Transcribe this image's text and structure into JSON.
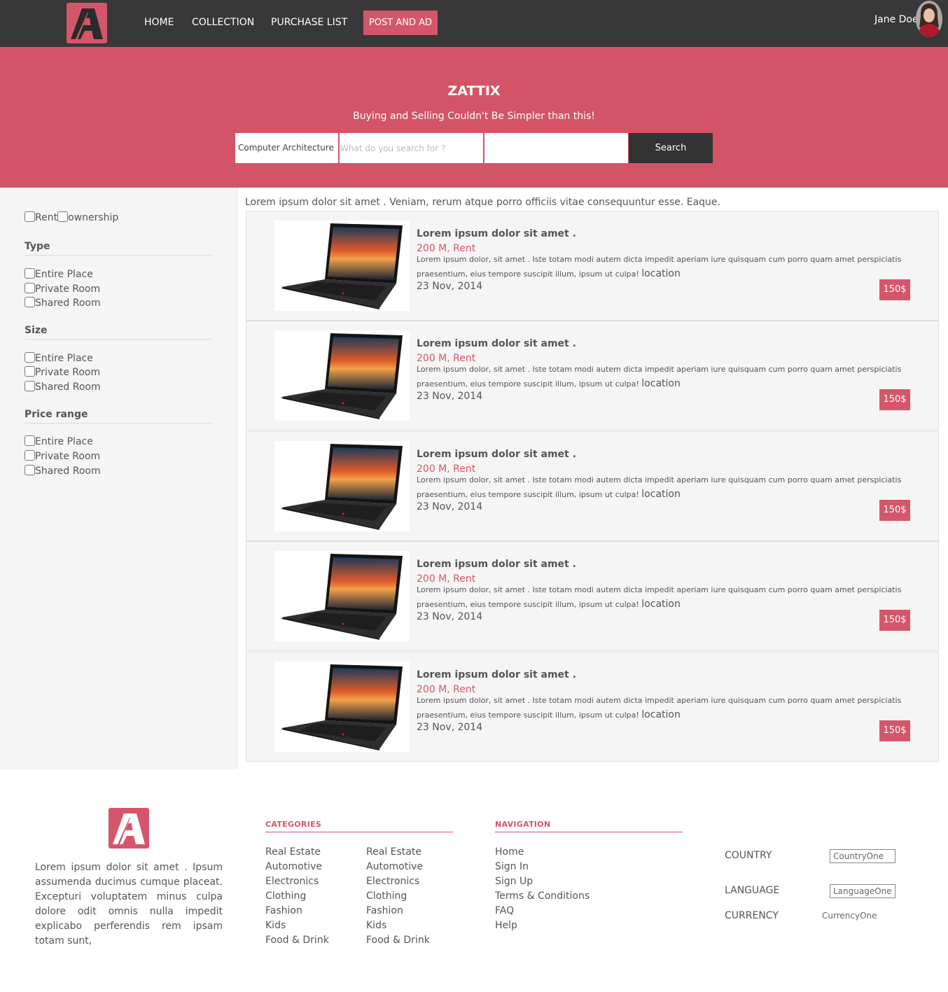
{
  "navbar": {
    "links": [
      "HOME",
      "COLLECTION",
      "PURCHASE LIST"
    ],
    "post_ad": "POST AND AD",
    "user_name": "Jane Doe"
  },
  "hero": {
    "title": "ZATTIX",
    "subtitle": "Buying and Selling Couldn't Be Simpler than this!",
    "category": "Computer Architecture",
    "search_placeholder": "What do you search for ?",
    "search_button": "Search"
  },
  "filters": {
    "deal_options": [
      "Rent",
      "ownership"
    ],
    "groups": [
      {
        "title": "Type",
        "options": [
          "Entire Place",
          "Private Room",
          "Shared Room"
        ]
      },
      {
        "title": "Size",
        "options": [
          "Entire Place",
          "Private Room",
          "Shared Room"
        ]
      },
      {
        "title": "Price range",
        "options": [
          "Entire Place",
          "Private Room",
          "Shared Room"
        ]
      }
    ]
  },
  "listings_intro": "Lorem ipsum dolor sit amet . Veniam, rerum atque porro officiis vitae consequuntur esse. Eaque.",
  "listings": [
    {
      "title": "Lorem ipsum dolor sit amet .",
      "price": "200 M, Rent",
      "description": "Lorem ipsum dolor, sit amet . Iste totam modi autem dicta impedit aperiam iure quisquam cum porro quam amet perspiciatis praesentium, eius tempore suscipit illum, ipsum ut culpa!",
      "location": "location",
      "date": "23 Nov, 2014",
      "badge": "150$"
    },
    {
      "title": "Lorem ipsum dolor sit amet .",
      "price": "200 M, Rent",
      "description": "Lorem ipsum dolor, sit amet . Iste totam modi autem dicta impedit aperiam iure quisquam cum porro quam amet perspiciatis praesentium, eius tempore suscipit illum, ipsum ut culpa!",
      "location": "location",
      "date": "23 Nov, 2014",
      "badge": "150$"
    },
    {
      "title": "Lorem ipsum dolor sit amet .",
      "price": "200 M, Rent",
      "description": "Lorem ipsum dolor, sit amet . Iste totam modi autem dicta impedit aperiam iure quisquam cum porro quam amet perspiciatis praesentium, eius tempore suscipit illum, ipsum ut culpa!",
      "location": "location",
      "date": "23 Nov, 2014",
      "badge": "150$"
    },
    {
      "title": "Lorem ipsum dolor sit amet .",
      "price": "200 M, Rent",
      "description": "Lorem ipsum dolor, sit amet . Iste totam modi autem dicta impedit aperiam iure quisquam cum porro quam amet perspiciatis praesentium, eius tempore suscipit illum, ipsum ut culpa!",
      "location": "location",
      "date": "23 Nov, 2014",
      "badge": "150$"
    },
    {
      "title": "Lorem ipsum dolor sit amet .",
      "price": "200 M, Rent",
      "description": "Lorem ipsum dolor, sit amet . Iste totam modi autem dicta impedit aperiam iure quisquam cum porro quam amet perspiciatis praesentium, eius tempore suscipit illum, ipsum ut culpa!",
      "location": "location",
      "date": "23 Nov, 2014",
      "badge": "150$"
    }
  ],
  "footer": {
    "about": "Lorem ipsum dolor sit amet . Ipsum assumenda ducimus cumque placeat. Excepturi voluptatem minus culpa dolore odit omnis nulla impedit explicabo perferendis rem ipsam totam sunt,",
    "categories_title": "CATEGORIES",
    "categories_col1": [
      "Real Estate",
      "Automotive",
      "Electronics",
      "Clothing",
      "Fashion",
      "Kids",
      "Food & Drink"
    ],
    "categories_col2": [
      "Real Estate",
      "Automotive",
      "Electronics",
      "Clothing",
      "Fashion",
      "Kids",
      "Food & Drink"
    ],
    "navigation_title": "NAVIGATION",
    "navigation": [
      "Home",
      "Sign In",
      "Sign Up",
      "Terms & Conditions",
      "FAQ",
      "Help"
    ],
    "country_label": "COUNTRY",
    "country_value": "CountryOne",
    "language_label": "LANGUAGE",
    "language_value": "LanguageOne",
    "currency_label": "CURRENCY",
    "currency_value": "CurrencyOne"
  },
  "colors": {
    "accent": "#d5566a",
    "hero_bg": "#d35466",
    "navbar_bg": "#383838",
    "button_dark": "#333333"
  },
  "icons": [
    "brand-logo-icon",
    "laptop-image",
    "user-avatar"
  ]
}
